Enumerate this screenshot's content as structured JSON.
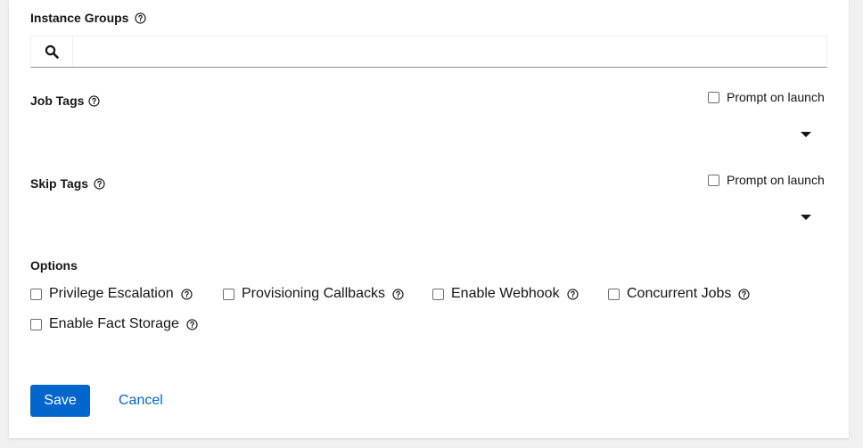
{
  "instance_groups": {
    "label": "Instance Groups",
    "search_value": "",
    "search_placeholder": ""
  },
  "job_tags": {
    "label": "Job Tags",
    "prompt_label": "Prompt on launch",
    "prompt_checked": false
  },
  "skip_tags": {
    "label": "Skip Tags",
    "prompt_label": "Prompt on launch",
    "prompt_checked": false
  },
  "options": {
    "label": "Options",
    "items": [
      {
        "label": "Privilege Escalation",
        "checked": false
      },
      {
        "label": "Provisioning Callbacks",
        "checked": false
      },
      {
        "label": "Enable Webhook",
        "checked": false
      },
      {
        "label": "Concurrent Jobs",
        "checked": false
      },
      {
        "label": "Enable Fact Storage",
        "checked": false
      }
    ]
  },
  "actions": {
    "save_label": "Save",
    "cancel_label": "Cancel"
  },
  "colors": {
    "primary": "#0066cc",
    "text": "#151515",
    "background": "#f0f0f0",
    "card": "#ffffff"
  },
  "icons": {
    "search": "search-icon",
    "help": "question-circle-icon",
    "caret": "caret-down-icon"
  }
}
